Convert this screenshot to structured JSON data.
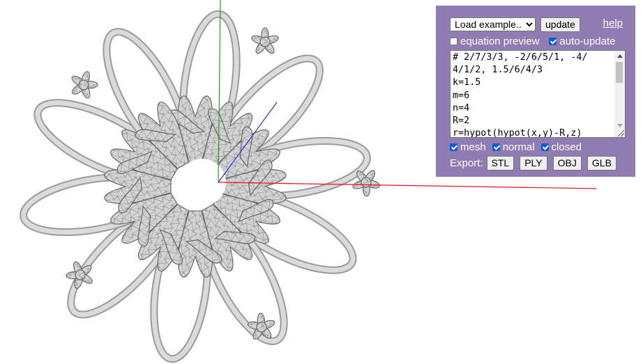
{
  "toolbar": {
    "example_select": "Load example...",
    "update_label": "update",
    "help_label": "help"
  },
  "options_top": {
    "equation_preview": {
      "label": "equation preview",
      "checked": false
    },
    "auto_update": {
      "label": "auto-update",
      "checked": true
    }
  },
  "editor": {
    "text": "# 2/7/3/3, -2/6/5/1, -4/\n4/1/2, 1.5/6/4/3\nk=1.5\nm=6\nn=4\nR=2\nr=hypot(hypot(x,y)-R,z)"
  },
  "options_bottom": {
    "mesh": {
      "label": "mesh",
      "checked": true
    },
    "normal": {
      "label": "normal",
      "checked": true
    },
    "closed": {
      "label": "closed",
      "checked": true
    }
  },
  "export": {
    "label": "Export:",
    "buttons": [
      "STL",
      "PLY",
      "OBJ",
      "GLB"
    ]
  },
  "colors": {
    "panel_bg": "#8f7cb3",
    "axis_x": "#e8112d",
    "axis_y": "#13a813",
    "axis_z": "#2a2ae0",
    "mesh_fill": "#cfcfcf",
    "mesh_edge": "#6b6b6b"
  }
}
